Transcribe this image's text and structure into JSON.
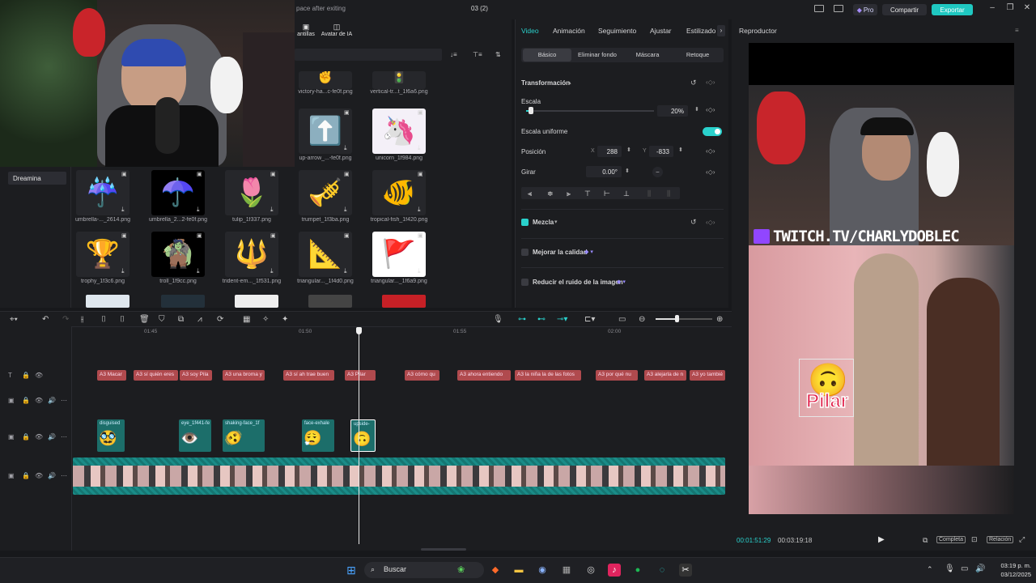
{
  "titlebar": {
    "file_label": "pace after exiting",
    "project_name": "03 (2)",
    "pro_label": "Pro",
    "share_label": "Compartir",
    "export_label": "Exportar"
  },
  "left_nav": {
    "item": "Dreamina"
  },
  "media": {
    "tabs": [
      {
        "label": "antillas"
      },
      {
        "label": "Avatar de IA"
      }
    ],
    "thumbs": [
      {
        "label": "victory-ha...c-fe0f.png",
        "emoji": "✌️"
      },
      {
        "label": "vertical-tr...t_1f6a6.png",
        "emoji": "🚦"
      },
      {
        "label": "up-arrow_...-fe0f.png",
        "emoji": "⬆️"
      },
      {
        "label": "unicorn_1f984.png",
        "emoji": "🦄"
      },
      {
        "label": "umbrella-..._2614.png",
        "emoji": "☔"
      },
      {
        "label": "umbrella_2...2-fe0f.png",
        "emoji": "☂️"
      },
      {
        "label": "tulip_1f337.png",
        "emoji": "🌷"
      },
      {
        "label": "trumpet_1f3ba.png",
        "emoji": "🎺"
      },
      {
        "label": "tropical-fish_1f420.png",
        "emoji": "🐠"
      },
      {
        "label": "trophy_1f3c6.png",
        "emoji": "🏆"
      },
      {
        "label": "troll_1f9cc.png",
        "emoji": "🧌"
      },
      {
        "label": "trident-em..._1f531.png",
        "emoji": "🔱"
      },
      {
        "label": "triangular..._1f4d0.png",
        "emoji": "📐"
      },
      {
        "label": "triangular..._1f6a9.png",
        "emoji": "🚩"
      }
    ]
  },
  "props": {
    "tabs": [
      "Video",
      "Animación",
      "Seguimiento",
      "Ajustar",
      "Estilizado"
    ],
    "sub_tabs": [
      "Básico",
      "Eliminar fondo",
      "Máscara",
      "Retoque"
    ],
    "transform_title": "Transformación",
    "scale_label": "Escala",
    "scale_value": "20%",
    "scale_fraction": 0.03,
    "uniform_label": "Escala uniforme",
    "position_label": "Posición",
    "pos_x_label": "X",
    "pos_x": "288",
    "pos_y_label": "Y",
    "pos_y": "-833",
    "rotate_label": "Girar",
    "rotate_value": "0.00°",
    "blend_label": "Mezcla",
    "enhance_label": "Mejorar la calidad",
    "denoise_label": "Reducir el ruido de la imagen"
  },
  "player": {
    "title": "Reproductor",
    "overlay_text": "TWITCH.TV/CHARLYDOBLEC",
    "sticker_text": "Pilar",
    "time_current": "00:01:51:29",
    "time_total": "00:03:19:18",
    "full_label": "Completa",
    "ratio_label": "Relación"
  },
  "timeline": {
    "ruler": [
      "01:45",
      "01:50",
      "01:55",
      "02:00"
    ],
    "text_clips": [
      "A3 Macar",
      "A3 sí quién eres",
      "A3 soy Pila",
      "A3 una broma y",
      "A3 sí ah trae buen",
      "A3 Pilar",
      "A3 cómo qu",
      "A3 ahora entiendo",
      "A3 la niña la de las fotos",
      "A3 por qué nu",
      "A3 alejarla de n",
      "A3 yo tambié"
    ],
    "sticker_clips": [
      {
        "name": "disguised",
        "emoji": "🥸"
      },
      {
        "name": "eye_1f441-fe",
        "emoji": "👁️"
      },
      {
        "name": "shaking-face_1f",
        "emoji": "🫨"
      },
      {
        "name": "face-exhale",
        "emoji": "😮‍💨"
      },
      {
        "name": "upside-",
        "emoji": "🙃"
      }
    ]
  },
  "taskbar": {
    "search_label": "Buscar",
    "time": "03:19 p. m.",
    "date": "03/12/2025"
  }
}
